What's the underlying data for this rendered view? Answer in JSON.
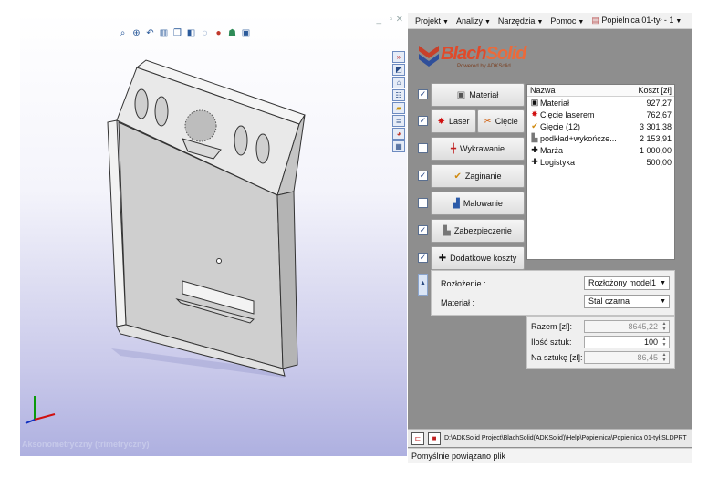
{
  "viewport": {
    "view_label": "Aksonometryczny (trimetryczny)",
    "toolbar_icons": [
      "zoom-fit-icon",
      "zoom-area-icon",
      "previous-view-icon",
      "section-view-icon",
      "view-orientation-icon",
      "display-style-icon",
      "hide-show-icon",
      "appearance-icon",
      "scene-icon",
      "view-settings-icon"
    ],
    "side_icons": [
      "expand-icon",
      "select-icon",
      "home-icon",
      "tree-icon",
      "folder-icon",
      "properties-icon",
      "color-icon",
      "calculator-icon"
    ]
  },
  "menubar": {
    "items": [
      "Projekt",
      "Analizy",
      "Narzędzia",
      "Pomoc"
    ],
    "document": "Popielnica 01-tył - 1"
  },
  "logo": {
    "brand_a": "Blach",
    "brand_b": "Solid",
    "tagline": "Powered by ADKSolid"
  },
  "operations": [
    {
      "checked": true,
      "label": "Materiał",
      "icon": "material-icon"
    },
    {
      "checked": true,
      "label": "Laser",
      "icon": "laser-icon",
      "label2": "Cięcie",
      "icon2": "cut-icon"
    },
    {
      "checked": false,
      "label": "Wykrawanie",
      "icon": "punching-icon"
    },
    {
      "checked": true,
      "label": "Zaginanie",
      "icon": "bending-icon"
    },
    {
      "checked": false,
      "label": "Malowanie",
      "icon": "painting-icon"
    },
    {
      "checked": true,
      "label": "Zabezpieczenie",
      "icon": "protection-icon"
    },
    {
      "checked": true,
      "label": "Dodatkowe koszty",
      "icon": "additional-costs-icon"
    }
  ],
  "cost_table": {
    "headers": [
      "Nazwa",
      "Koszt [zł]"
    ],
    "rows": [
      {
        "name": "Materiał",
        "cost": "927,27",
        "icon": "material-icon"
      },
      {
        "name": "Cięcie laserem",
        "cost": "762,67",
        "icon": "laser-icon"
      },
      {
        "name": "Gięcie (12)",
        "cost": "3 301,38",
        "icon": "bending-icon"
      },
      {
        "name": "podkład+wykończe...",
        "cost": "2 153,91",
        "icon": "painting-icon"
      },
      {
        "name": "Marża",
        "cost": "1 000,00",
        "icon": "additional-costs-icon"
      },
      {
        "name": "Logistyka",
        "cost": "500,00",
        "icon": "additional-costs-icon"
      }
    ]
  },
  "settings": {
    "layout_label": "Rozłożenie :",
    "layout_value": "Rozłożony model1",
    "material_label": "Materiał :",
    "material_value": "Stal czarna"
  },
  "totals": {
    "total_label": "Razem [zł]:",
    "total_value": "8645,22",
    "qty_label": "Ilość sztuk:",
    "qty_value": "100",
    "per_piece_label": "Na sztukę [zł]:",
    "per_piece_value": "86,45"
  },
  "pathbar": {
    "path": "D:\\ADKSolid Project\\BlachSolid(ADKSolid)\\Help\\Popielnica\\Popielnica 01-tył.SLDPRT"
  },
  "status": {
    "text": "Pomyślnie powiązano plik"
  }
}
